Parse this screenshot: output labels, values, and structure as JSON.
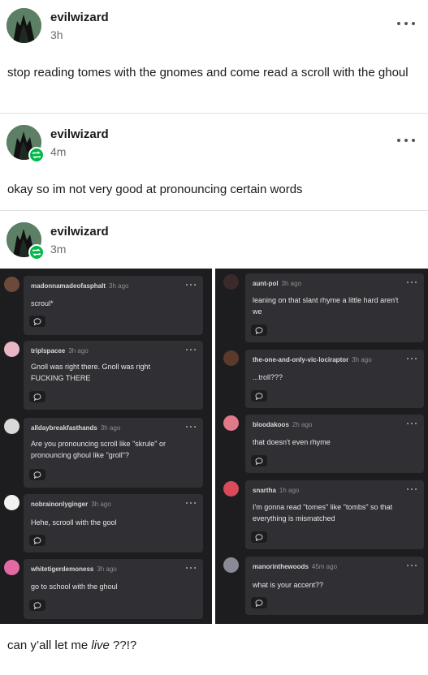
{
  "posts": [
    {
      "username": "evilwizard",
      "time": "3h",
      "text": "stop reading tomes with the gnomes and come read a scroll with the ghoul"
    },
    {
      "username": "evilwizard",
      "time": "4m",
      "text": "okay so im not very good at pronouncing certain words"
    },
    {
      "username": "evilwizard",
      "time": "3m"
    }
  ],
  "replies_left": [
    {
      "user": "madonnamadeofasphalt",
      "time": "3h ago",
      "text": "scroul*",
      "avatar_color": "#6b4a3a"
    },
    {
      "user": "triplspacee",
      "time": "3h ago",
      "text": "Gnoll was right there. Gnoll was right FUCKING THERE",
      "avatar_color": "#e9b6c6"
    },
    {
      "user": "alldaybreakfasthands",
      "time": "3h ago",
      "text": "Are you pronouncing scroll like \"skrule\" or pronouncing ghoul like \"groll\"?",
      "avatar_color": "#d9d9d9"
    },
    {
      "user": "nobrainonlyginger",
      "time": "3h ago",
      "text": "Hehe, scrooll with the gool",
      "avatar_color": "#f2f2f2"
    },
    {
      "user": "whitetigerdemoness",
      "time": "3h ago",
      "text": "go to school with the ghoul",
      "avatar_color": "#e46aa3"
    }
  ],
  "replies_right": [
    {
      "user": "aunt-pol",
      "time": "3h ago",
      "text": "leaning on that slant rhyme a little hard aren't we",
      "avatar_color": "#3a2a2a"
    },
    {
      "user": "the-one-and-only-vic-lociraptor",
      "time": "3h ago",
      "text": "...troll???",
      "avatar_color": "#5a3a2a"
    },
    {
      "user": "bloodakoos",
      "time": "2h ago",
      "text": "that doesn't even rhyme",
      "avatar_color": "#e07a8a"
    },
    {
      "user": "snartha",
      "time": "1h ago",
      "text": "I'm gonna read \"tomes\" like \"tombs\" so that everything is mismatched",
      "avatar_color": "#d94a5a"
    },
    {
      "user": "manorinthewoods",
      "time": "45m ago",
      "text": "what is your accent??",
      "avatar_color": "#8a8a96"
    }
  ],
  "final": {
    "before": "can y’all let me ",
    "emphasis": "live",
    "after": " ??!?"
  },
  "colors": {
    "reblog": "#00b94a",
    "panel_bg": "#1d1d1f",
    "card_bg": "#303034"
  },
  "icons": {
    "menu": "ellipsis-icon",
    "reblog": "reblog-icon",
    "reply": "speech-bubble-icon"
  }
}
